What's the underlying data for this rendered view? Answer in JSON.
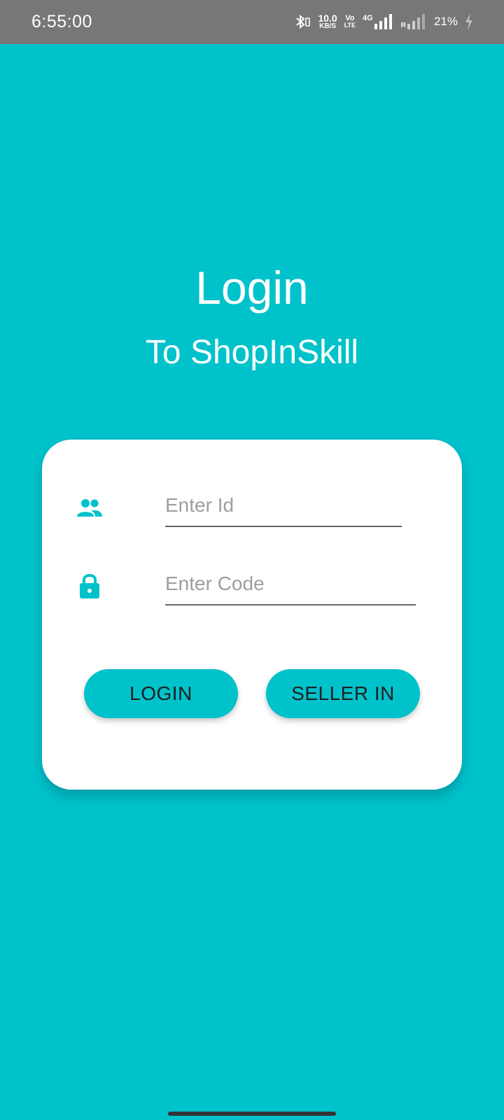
{
  "status_bar": {
    "time": "6:55:00",
    "net_speed_value": "10.0",
    "net_speed_unit": "KB/S",
    "volte_top": "Vo",
    "volte_bottom": "LTE",
    "network_type": "4G",
    "roaming": "R",
    "battery": "21%",
    "icons": [
      "bluetooth-icon",
      "signal-icon",
      "battery-charging-icon"
    ]
  },
  "header": {
    "title": "Login",
    "subtitle": "To ShopInSkill"
  },
  "form": {
    "id_placeholder": "Enter Id",
    "code_placeholder": "Enter Code",
    "id_icon": "people-icon",
    "code_icon": "lock-icon"
  },
  "buttons": {
    "login_label": "LOGIN",
    "seller_label": "SELLER IN"
  },
  "colors": {
    "background": "#00c2cb",
    "status_bar": "#777777",
    "card": "#ffffff",
    "accent": "#00c2cb"
  }
}
